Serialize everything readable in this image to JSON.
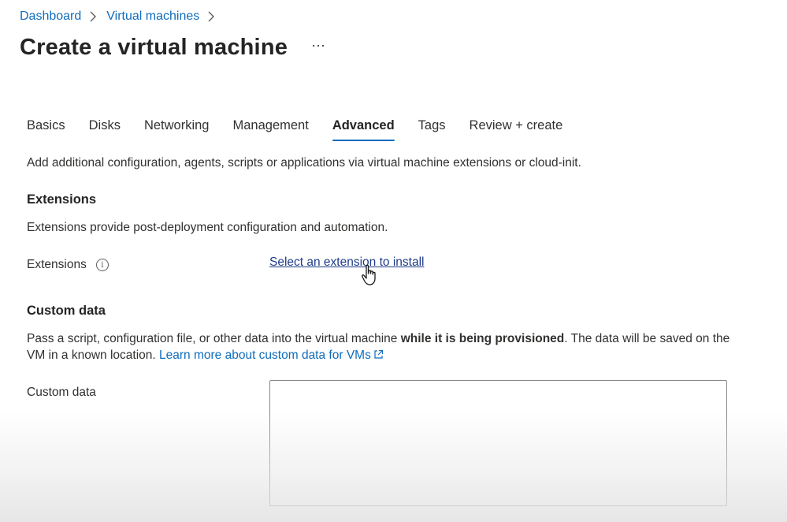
{
  "breadcrumb": {
    "items": [
      "Dashboard",
      "Virtual machines"
    ]
  },
  "page": {
    "title": "Create a virtual machine",
    "more_label": "···"
  },
  "tabs": [
    {
      "label": "Basics",
      "active": false
    },
    {
      "label": "Disks",
      "active": false
    },
    {
      "label": "Networking",
      "active": false
    },
    {
      "label": "Management",
      "active": false
    },
    {
      "label": "Advanced",
      "active": true
    },
    {
      "label": "Tags",
      "active": false
    },
    {
      "label": "Review + create",
      "active": false
    }
  ],
  "intro": "Add additional configuration, agents, scripts or applications via virtual machine extensions or cloud-init.",
  "extensions": {
    "heading": "Extensions",
    "description": "Extensions provide post-deployment configuration and automation.",
    "field_label": "Extensions",
    "link": "Select an extension to install"
  },
  "custom_data": {
    "heading": "Custom data",
    "desc_part1": "Pass a script, configuration file, or other data into the virtual machine ",
    "desc_bold": "while it is being provisioned",
    "desc_part2": ". The data will be saved on the VM in a known location. ",
    "learn_more": "Learn more about custom data for VMs",
    "field_label": "Custom data",
    "value": ""
  },
  "colors": {
    "link": "#0f6cbd",
    "active_tab_underline": "#0f6cbd"
  },
  "icons": {
    "breadcrumb_separator": "chevron-right-icon",
    "info": "info-icon",
    "external_link": "external-link-icon",
    "cursor": "hand-pointer-icon"
  }
}
